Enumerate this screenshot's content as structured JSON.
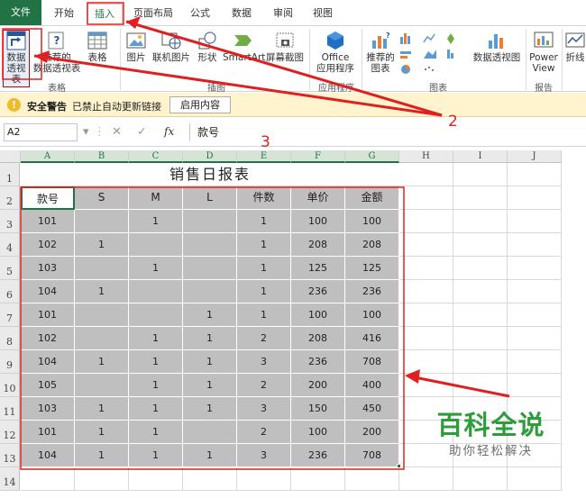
{
  "ribbon_tabs": [
    "文件",
    "开始",
    "插入",
    "页面布局",
    "公式",
    "数据",
    "审阅",
    "视图"
  ],
  "active_tab": "插入",
  "ribbon": {
    "pivot_table": [
      "数据",
      "透视表"
    ],
    "recommended_pivot": [
      "推荐的",
      "数据透视表"
    ],
    "table": "表格",
    "picture": "图片",
    "online_picture": "联机图片",
    "shapes": "形状",
    "smartart": "SmartArt",
    "screenshot": "屏幕截图",
    "office_addins": [
      "Office",
      "应用程序"
    ],
    "recommended_charts": [
      "推荐的",
      "图表"
    ],
    "pivot_chart": "数据透视图",
    "power_view": [
      "Power",
      "View"
    ],
    "line_spark": "折线",
    "groups": {
      "tables": "表格",
      "illustrations": "插图",
      "apps": "应用程序",
      "charts": "图表",
      "reports": "报告"
    }
  },
  "security_bar": {
    "title": "安全警告",
    "message": "已禁止自动更新链接",
    "button": "启用内容"
  },
  "formula_bar": {
    "name_box": "A2",
    "fx": "fx",
    "content": "款号"
  },
  "columns": [
    "A",
    "B",
    "C",
    "D",
    "E",
    "F",
    "G",
    "H",
    "I",
    "J"
  ],
  "row_numbers": [
    "1",
    "2",
    "3",
    "4",
    "5",
    "6",
    "7",
    "8",
    "9",
    "10",
    "11",
    "12",
    "13",
    "14"
  ],
  "sheet": {
    "title": "销售日报表",
    "headers": [
      "款号",
      "S",
      "M",
      "L",
      "件数",
      "单价",
      "金额"
    ],
    "rows": [
      [
        "101",
        "",
        "1",
        "",
        "1",
        "100",
        "100"
      ],
      [
        "102",
        "1",
        "",
        "",
        "1",
        "208",
        "208"
      ],
      [
        "103",
        "",
        "1",
        "",
        "1",
        "125",
        "125"
      ],
      [
        "104",
        "1",
        "",
        "",
        "1",
        "236",
        "236"
      ],
      [
        "101",
        "",
        "",
        "1",
        "1",
        "100",
        "100"
      ],
      [
        "102",
        "",
        "1",
        "1",
        "2",
        "208",
        "416"
      ],
      [
        "104",
        "1",
        "1",
        "1",
        "3",
        "236",
        "708"
      ],
      [
        "105",
        "",
        "1",
        "1",
        "2",
        "200",
        "400"
      ],
      [
        "103",
        "1",
        "1",
        "1",
        "3",
        "150",
        "450"
      ],
      [
        "101",
        "1",
        "1",
        "",
        "2",
        "100",
        "200"
      ],
      [
        "104",
        "1",
        "1",
        "1",
        "3",
        "236",
        "708"
      ]
    ]
  },
  "annotations": {
    "step2": "2",
    "step3": "3",
    "arrow_color": "#e02020"
  },
  "watermark": {
    "line1": "百科全说",
    "line2": "助你轻松解决"
  },
  "colors": {
    "excel_green": "#217346",
    "data_fill": "#bfbfbf",
    "security_bar": "#fff4ce",
    "watermark_green": "#2e9c3b"
  }
}
